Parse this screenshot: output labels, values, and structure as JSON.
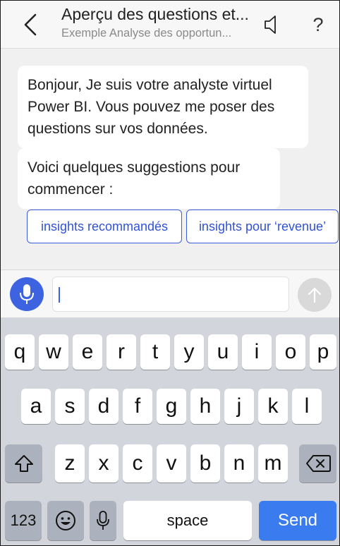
{
  "header": {
    "title": "Aperçu des questions et...",
    "subtitle": "Exemple Analyse des opportun..."
  },
  "chat": {
    "messages": [
      "Bonjour, Je suis votre analyste virtuel Power BI. Vous pouvez me poser des questions sur vos données.",
      "Voici quelques suggestions pour commencer :"
    ],
    "suggestions": [
      "insights recommandés",
      "insights pour ‘revenue’"
    ]
  },
  "input": {
    "value": "",
    "placeholder": ""
  },
  "keyboard": {
    "row1": [
      "q",
      "w",
      "e",
      "r",
      "t",
      "y",
      "u",
      "i",
      "o",
      "p"
    ],
    "row2": [
      "a",
      "s",
      "d",
      "f",
      "g",
      "h",
      "j",
      "k",
      "l"
    ],
    "row3": [
      "z",
      "x",
      "c",
      "v",
      "b",
      "n",
      "m"
    ],
    "numbers_label": "123",
    "space_label": "space",
    "send_label": "Send"
  },
  "colors": {
    "accent": "#3d63e0",
    "send_key": "#3a7bf0",
    "keyboard_bg": "#d2d5db"
  }
}
